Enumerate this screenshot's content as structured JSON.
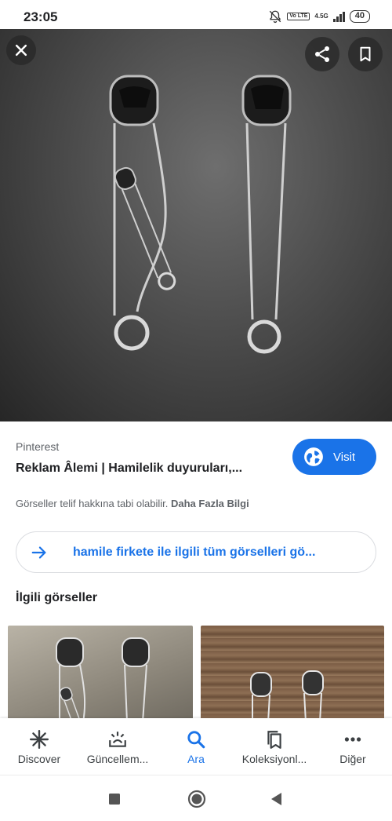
{
  "status_bar": {
    "time": "23:05",
    "volte": "Vo LTE",
    "network": "4.5G",
    "battery": "40"
  },
  "image_viewer": {
    "close_icon": "close-icon",
    "share_icon": "share-icon",
    "save_icon": "bookmark-icon"
  },
  "result": {
    "source": "Pinterest",
    "title": "Reklam Âlemi | Hamilelik duyuruları,...",
    "visit_label": "Visit",
    "visit_icon": "globe-icon",
    "copyright_text": "Görseller telif hakkına tabi olabilir.",
    "learn_more": "Daha Fazla Bilgi"
  },
  "all_images_link": {
    "label": "hamile firkete ile ilgili tüm görselleri gö...",
    "icon": "arrow-right-icon"
  },
  "related": {
    "heading": "İlgili görseller"
  },
  "bottom_nav": {
    "items": [
      {
        "label": "Discover",
        "icon": "asterisk-icon",
        "active": false
      },
      {
        "label": "Güncellem...",
        "icon": "updates-icon",
        "active": false
      },
      {
        "label": "Ara",
        "icon": "search-icon",
        "active": true
      },
      {
        "label": "Koleksiyonl...",
        "icon": "collections-icon",
        "active": false
      },
      {
        "label": "Diğer",
        "icon": "more-icon",
        "active": false
      }
    ]
  },
  "colors": {
    "accent": "#1a73e8",
    "text_primary": "#202124",
    "text_secondary": "#5f6368"
  }
}
